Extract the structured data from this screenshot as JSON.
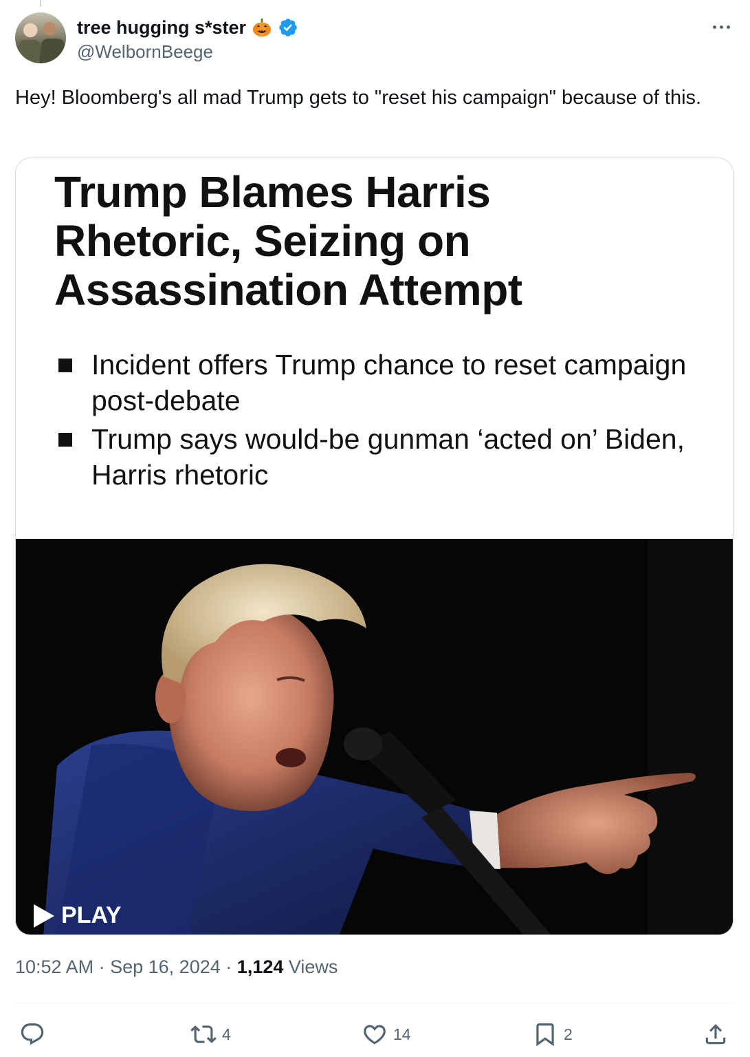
{
  "user": {
    "display_name": "tree hugging s*ster",
    "handle": "@WelbornBeege"
  },
  "tweet": {
    "text": "Hey! Bloomberg's all mad Trump gets to \"reset his campaign\" because of this."
  },
  "card": {
    "headline": "Trump Blames Harris Rhetoric, Seizing on Assassination Attempt",
    "bullets": [
      "Incident offers Trump chance to reset campaign post-debate",
      "Trump says would-be gunman ‘acted on’ Biden, Harris rhetoric"
    ],
    "play_label": "PLAY"
  },
  "meta": {
    "time": "10:52 AM",
    "date": "Sep 16, 2024",
    "separator": "·",
    "views_count": "1,124",
    "views_label": "Views"
  },
  "actions": {
    "reposts": "4",
    "likes": "14",
    "bookmarks": "2"
  },
  "icons": {
    "reply": "reply-icon",
    "repost": "repost-icon",
    "like": "heart-icon",
    "bookmark": "bookmark-icon",
    "share": "share-icon",
    "more": "more-icon",
    "verified": "verified-icon",
    "pumpkin": "pumpkin-emoji-icon"
  },
  "colors": {
    "text": "#0f1419",
    "secondary": "#536471",
    "verified": "#1d9bf0",
    "border": "#cfd9de"
  }
}
